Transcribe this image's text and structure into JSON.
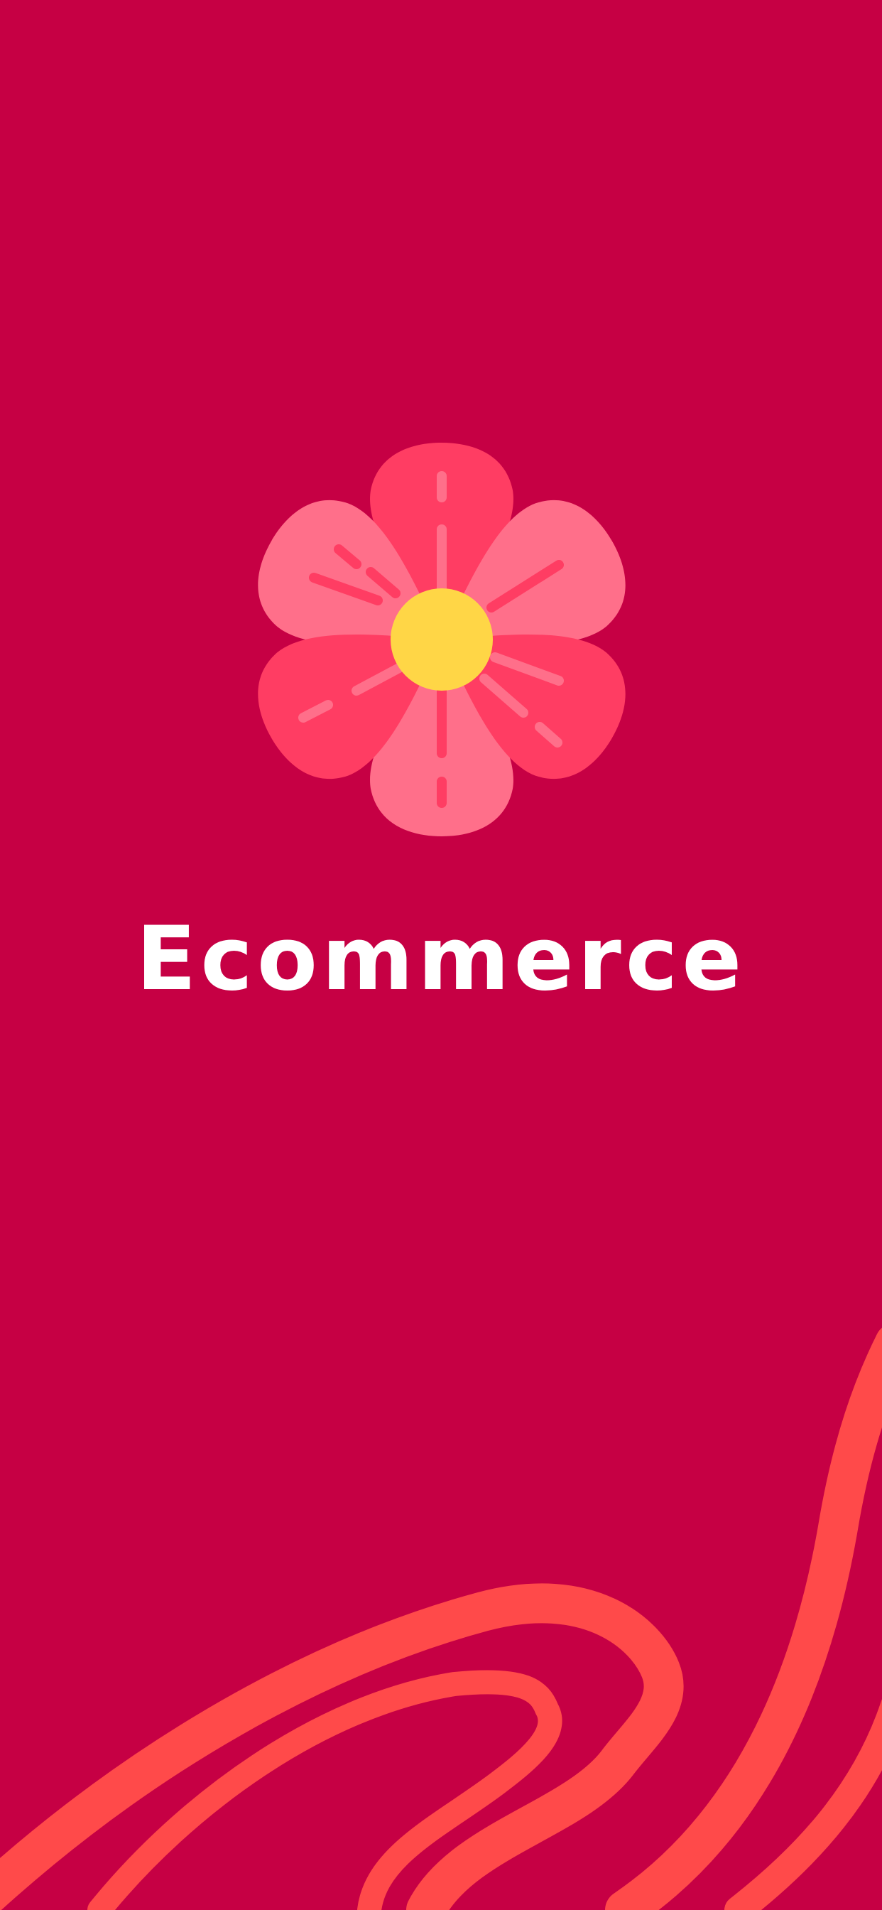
{
  "app": {
    "title": "Ecommerce"
  },
  "colors": {
    "background": "#C60044",
    "petal_dark": "#FF3D63",
    "petal_light": "#FF6F8A",
    "center": "#FFD646",
    "wave": "#FF4A4A",
    "title_text": "#FFFFFF"
  },
  "icons": {
    "logo": "flower-icon"
  }
}
